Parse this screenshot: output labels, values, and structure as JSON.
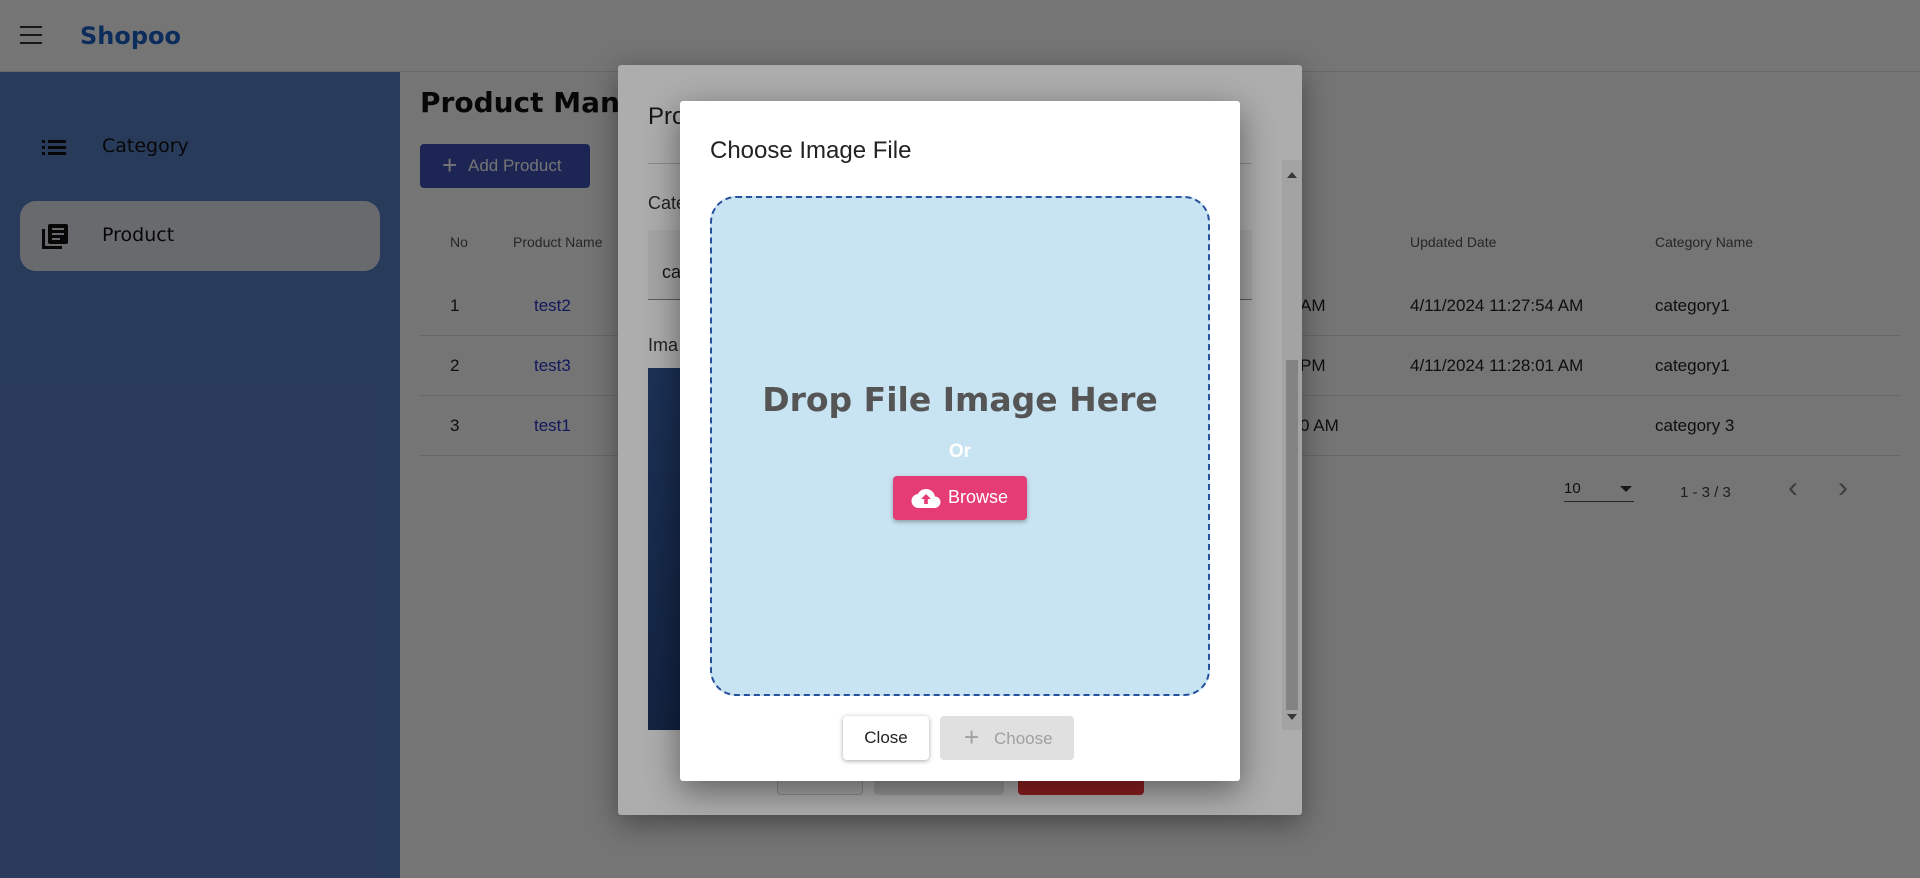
{
  "app": {
    "brand": "Shopoo"
  },
  "sidebar": {
    "items": [
      {
        "label": "Category",
        "icon": "list-icon",
        "active": false
      },
      {
        "label": "Product",
        "icon": "library-books-icon",
        "active": true
      }
    ]
  },
  "main": {
    "title": "Product Mana",
    "add_button": "Add Product",
    "table": {
      "headers": [
        "No",
        "Product Name",
        "Updated Date",
        "Category Name"
      ],
      "rows": [
        {
          "no": "1",
          "name": "test2",
          "created_tail": "AM",
          "updated": "4/11/2024 11:27:54 AM",
          "category": "category1"
        },
        {
          "no": "2",
          "name": "test3",
          "created_tail": "PM",
          "updated": "4/11/2024 11:28:01 AM",
          "category": "category1"
        },
        {
          "no": "3",
          "name": "test1",
          "created_tail": "0 AM",
          "updated": "",
          "category": "category 3"
        }
      ]
    },
    "pagination": {
      "page_size": "10",
      "range": "1 - 3 / 3"
    }
  },
  "product_dialog": {
    "title": "Pro",
    "category_label": "Cate",
    "category_value": "ca",
    "image_label": "Ima"
  },
  "image_dialog": {
    "title": "Choose Image File",
    "drop_text": "Drop File Image Here",
    "or_text": "Or",
    "browse_label": "Browse",
    "close_label": "Close",
    "choose_label": "Choose"
  },
  "colors": {
    "brand": "#1b62c9",
    "sidebar": "#5b80c8",
    "primary": "#3f51b5",
    "accent": "#e53c76",
    "drop_zone": "#c8e3f1",
    "delete": "#d32f2f"
  }
}
